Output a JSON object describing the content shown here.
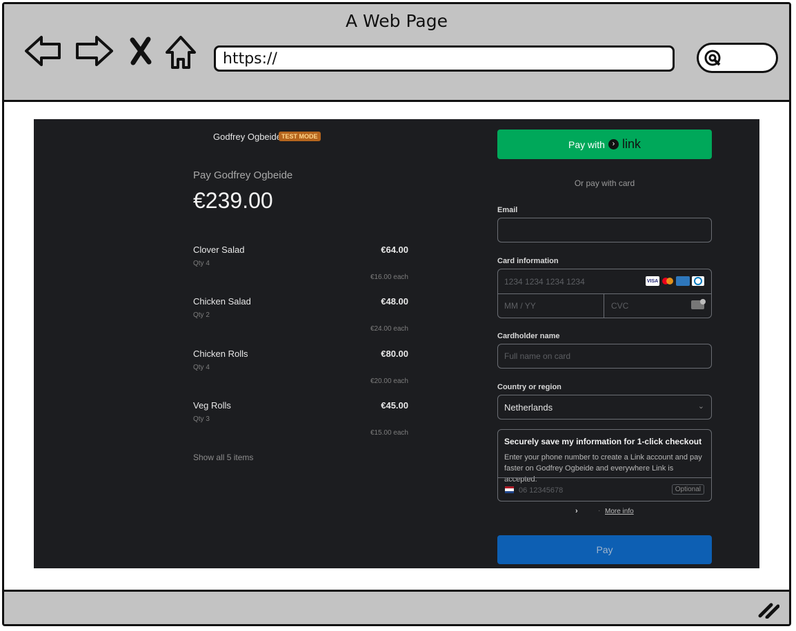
{
  "browser": {
    "title": "A Web Page",
    "url": "https://",
    "icons": [
      "back-arrow-icon",
      "forward-arrow-icon",
      "close-x-icon",
      "home-icon",
      "search-icon",
      "resize-grip-icon"
    ]
  },
  "checkout": {
    "merchant_name": "Godfrey Ogbeide",
    "mode_badge": "TEST MODE",
    "pay_to": "Pay Godfrey Ogbeide",
    "total": "€239.00",
    "items": [
      {
        "name": "Clover Salad",
        "qty": "Qty 4",
        "price": "€64.00",
        "each": "€16.00 each"
      },
      {
        "name": "Chicken Salad",
        "qty": "Qty 2",
        "price": "€48.00",
        "each": "€24.00 each"
      },
      {
        "name": "Chicken Rolls",
        "qty": "Qty 4",
        "price": "€80.00",
        "each": "€20.00 each"
      },
      {
        "name": "Veg Rolls",
        "qty": "Qty 3",
        "price": "€45.00",
        "each": "€15.00 each"
      }
    ],
    "show_all": "Show all 5 items"
  },
  "payment": {
    "link_button_prefix": "Pay with",
    "link_word": "link",
    "or_pay_card": "Or pay with card",
    "email_label": "Email",
    "email_value": "",
    "card_label": "Card information",
    "card_number_placeholder": "1234 1234 1234 1234",
    "expiry_placeholder": "MM / YY",
    "cvc_placeholder": "CVC",
    "brand_visa": "VISA",
    "cardholder_label": "Cardholder name",
    "cardholder_placeholder": "Full name on card",
    "country_label": "Country or region",
    "country_value": "Netherlands",
    "save_title": "Securely save my information for 1-click checkout",
    "save_desc": "Enter your phone number to create a Link account and pay faster on Godfrey Ogbeide and everywhere Link is accepted.",
    "phone_placeholder": "06 12345678",
    "optional": "Optional",
    "more_info": "More info",
    "pay_button": "Pay"
  },
  "colors": {
    "panel_bg": "#1c1d20",
    "link_green": "#00a85a",
    "pay_blue": "#0d5fb3",
    "badge_orange": "#b5651d",
    "browser_gray": "#c3c3c3"
  }
}
